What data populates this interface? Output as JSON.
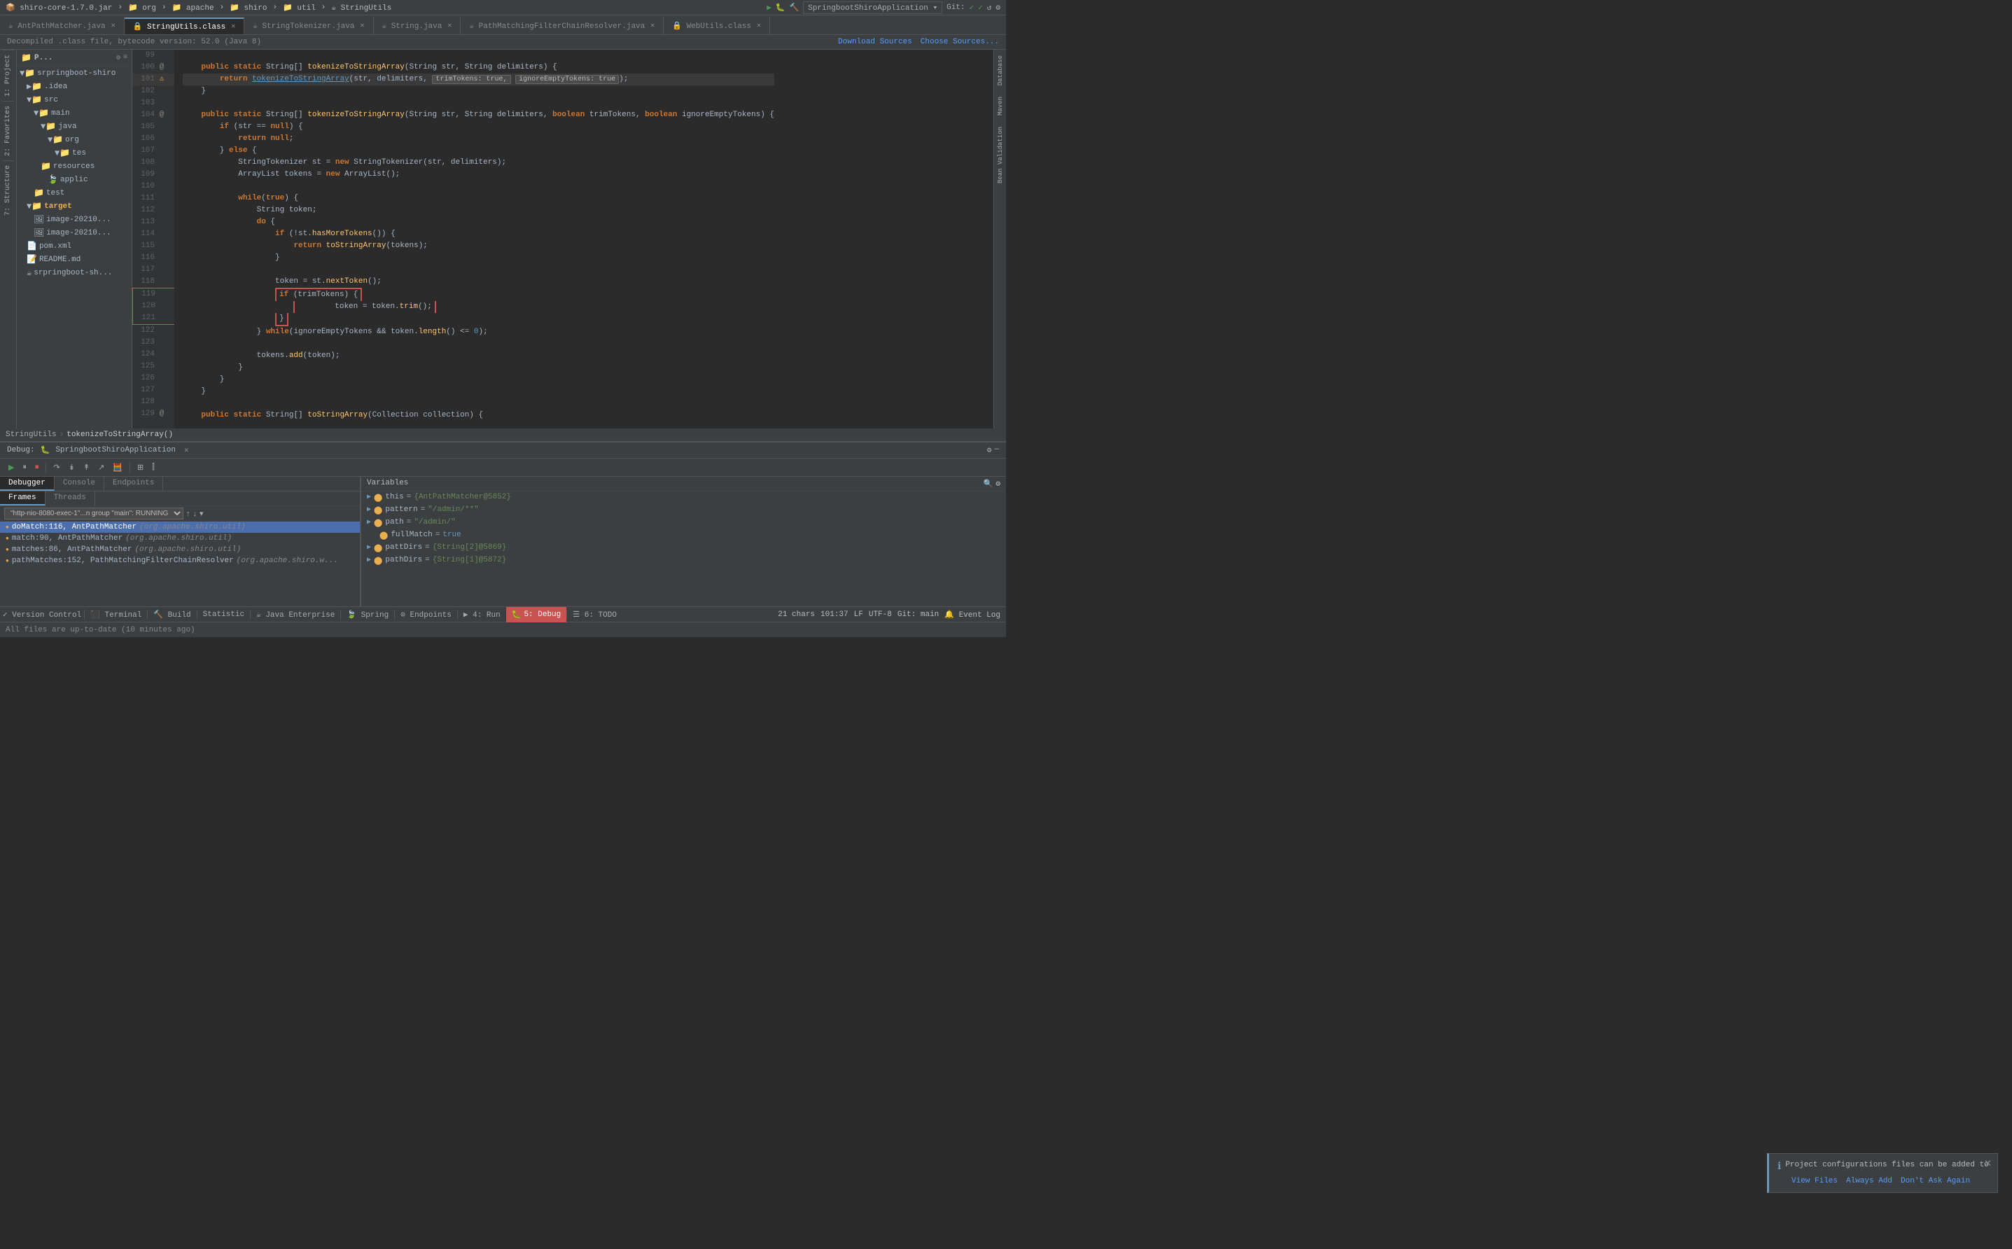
{
  "titlebar": {
    "items": [
      "shiro-core-1.7.0.jar",
      "org",
      "apache",
      "shiro",
      "util",
      "StringUtils"
    ],
    "app_dropdown": "SpringbootShiroApplication",
    "git_label": "Git:"
  },
  "tabs": [
    {
      "label": "AntPathMatcher.java",
      "active": false
    },
    {
      "label": "StringUtils.class",
      "active": true
    },
    {
      "label": "StringTokenizer.java",
      "active": false
    },
    {
      "label": "String.java",
      "active": false
    },
    {
      "label": "PathMatchingFilterChainResolver.java",
      "active": false
    },
    {
      "label": "WebUtils.class",
      "active": false
    }
  ],
  "decompile_bar": {
    "text": "Decompiled .class file, bytecode version: 52.0 (Java 8)",
    "link1": "Download Sources",
    "link2": "Choose Sources..."
  },
  "breadcrumb": {
    "items": [
      "StringUtils",
      "tokenizeToStringArray()"
    ]
  },
  "code_lines": [
    {
      "ln": "99",
      "gutter": "",
      "code": ""
    },
    {
      "ln": "100",
      "gutter": "@",
      "code": "    public static String[] tokenizeToStringArray(String str, String delimiters) {"
    },
    {
      "ln": "101",
      "gutter": "●",
      "code": "        return tokenizeToStringArray(str, delimiters,  trimTokens: true,  ignoreEmptyTokens: true);"
    },
    {
      "ln": "102",
      "gutter": "",
      "code": "    }"
    },
    {
      "ln": "103",
      "gutter": "",
      "code": ""
    },
    {
      "ln": "104",
      "gutter": "@",
      "code": "    public static String[] tokenizeToStringArray(String str, String delimiters, boolean trimTokens, boolean ignoreEmptyTokens) {"
    },
    {
      "ln": "105",
      "gutter": "",
      "code": "        if (str == null) {"
    },
    {
      "ln": "106",
      "gutter": "",
      "code": "            return null;"
    },
    {
      "ln": "107",
      "gutter": "",
      "code": "        } else {"
    },
    {
      "ln": "108",
      "gutter": "",
      "code": "            StringTokenizer st = new StringTokenizer(str, delimiters);"
    },
    {
      "ln": "109",
      "gutter": "",
      "code": "            ArrayList tokens = new ArrayList();"
    },
    {
      "ln": "110",
      "gutter": "",
      "code": ""
    },
    {
      "ln": "111",
      "gutter": "",
      "code": "            while(true) {"
    },
    {
      "ln": "112",
      "gutter": "",
      "code": "                String token;"
    },
    {
      "ln": "113",
      "gutter": "",
      "code": "                do {"
    },
    {
      "ln": "114",
      "gutter": "",
      "code": "                    if (!st.hasMoreTokens()) {"
    },
    {
      "ln": "115",
      "gutter": "",
      "code": "                        return toStringArray(tokens);"
    },
    {
      "ln": "116",
      "gutter": "",
      "code": "                    }"
    },
    {
      "ln": "117",
      "gutter": "",
      "code": ""
    },
    {
      "ln": "118",
      "gutter": "",
      "code": "                    token = st.nextToken();"
    },
    {
      "ln": "119",
      "gutter": "",
      "code": "                    if (trimTokens) {"
    },
    {
      "ln": "120",
      "gutter": "",
      "code": "                        token = token.trim();"
    },
    {
      "ln": "121",
      "gutter": "",
      "code": "                    }"
    },
    {
      "ln": "122",
      "gutter": "",
      "code": "                } while(ignoreEmptyTokens && token.length() <= 0);"
    },
    {
      "ln": "123",
      "gutter": "",
      "code": ""
    },
    {
      "ln": "124",
      "gutter": "",
      "code": "                tokens.add(token);"
    },
    {
      "ln": "125",
      "gutter": "",
      "code": "            }"
    },
    {
      "ln": "126",
      "gutter": "",
      "code": "        }"
    },
    {
      "ln": "127",
      "gutter": "",
      "code": "    }"
    },
    {
      "ln": "128",
      "gutter": "",
      "code": ""
    },
    {
      "ln": "129",
      "gutter": "@",
      "code": "    public static String[] toStringArray(Collection collection) {"
    }
  ],
  "project_tree": {
    "root": "srpringboot-shiro",
    "items": [
      {
        "label": ".idea",
        "indent": 1,
        "type": "folder"
      },
      {
        "label": "src",
        "indent": 1,
        "type": "folder"
      },
      {
        "label": "main",
        "indent": 2,
        "type": "folder"
      },
      {
        "label": "java",
        "indent": 3,
        "type": "folder"
      },
      {
        "label": "org",
        "indent": 4,
        "type": "folder"
      },
      {
        "label": "tes",
        "indent": 5,
        "type": "folder"
      },
      {
        "label": "resources",
        "indent": 3,
        "type": "folder"
      },
      {
        "label": "applic",
        "indent": 4,
        "type": "file-config"
      },
      {
        "label": "test",
        "indent": 2,
        "type": "folder"
      },
      {
        "label": "target",
        "indent": 1,
        "type": "folder",
        "expanded": true
      },
      {
        "label": "image-20210",
        "indent": 2,
        "type": "image"
      },
      {
        "label": "image-20210",
        "indent": 2,
        "type": "image"
      },
      {
        "label": "pom.xml",
        "indent": 1,
        "type": "xml",
        "selected": false
      },
      {
        "label": "README.md",
        "indent": 1,
        "type": "md"
      },
      {
        "label": "srpringboot-sh",
        "indent": 1,
        "type": "jar"
      }
    ]
  },
  "debug": {
    "title": "Debug:",
    "app": "SpringbootShiroApplication",
    "toolbar_buttons": [
      "▶",
      "⏸",
      "⏹",
      "↩",
      "↪",
      "↗",
      "↙",
      "↕",
      "☰",
      "⊞"
    ],
    "tabs": [
      "Debugger",
      "Console",
      "Endpoints"
    ],
    "frames_tabs": [
      "Frames",
      "Threads"
    ],
    "thread_label": "\"http-nio-8080-exec-1\"...n group \"main\": RUNNING",
    "frames": [
      {
        "label": "doMatch:116, AntPathMatcher",
        "detail": "(org.apache.shiro.util)",
        "active": true
      },
      {
        "label": "match:90, AntPathMatcher",
        "detail": "(org.apache.shiro.util)",
        "active": false
      },
      {
        "label": "matches:86, AntPathMatcher",
        "detail": "(org.apache.shiro.util)",
        "active": false
      },
      {
        "label": "pathMatches:152, PathMatchingFilterChainResolver",
        "detail": "(org.apache.shiro.w...",
        "active": false
      }
    ],
    "variables_header": "Variables",
    "variables": [
      {
        "indent": 0,
        "name": "this",
        "eq": "=",
        "val": "{AntPathMatcher@5852}",
        "expanded": true
      },
      {
        "indent": 0,
        "name": "pattern",
        "eq": "=",
        "val": "\"/admin/**\"",
        "expanded": false
      },
      {
        "indent": 0,
        "name": "path",
        "eq": "=",
        "val": "\"/admin/\"",
        "expanded": false
      },
      {
        "indent": 0,
        "name": "fullMatch",
        "eq": "=",
        "val": "true",
        "expanded": false
      },
      {
        "indent": 0,
        "name": "pattDirs",
        "eq": "=",
        "val": "= {String[2]@5869}",
        "expanded": false
      },
      {
        "indent": 0,
        "name": "pathDirs",
        "eq": "=",
        "val": "= {String[1]@5872}",
        "expanded": false
      }
    ]
  },
  "notification": {
    "text": "Project configurations files can be added to",
    "actions": [
      "View Files",
      "Always Add",
      "Don't Ask Again"
    ]
  },
  "statusbar": {
    "left": [
      "✓ Version Control",
      "⊞ Terminal",
      "☰ Build",
      "Statistic",
      "Java Enterprise",
      "Spring",
      "⊙ Endpoints",
      "▶ 4: Run",
      "🐛 5: Debug",
      "☰ 6: TODO"
    ],
    "right": [
      "21 chars",
      "101:37",
      "LF",
      "UTF-8",
      "Git: main"
    ],
    "files_status": "All files are up-to-date (10 minutes ago)",
    "event_log": "Event Log"
  },
  "colors": {
    "accent_blue": "#4b6eaf",
    "active_tab_border": "#6897bb",
    "bg_main": "#2b2b2b",
    "bg_secondary": "#3c3f41",
    "keyword": "#cc7832",
    "string": "#6a8759",
    "number": "#6897bb",
    "method": "#ffc66d",
    "red_debug": "#c75450",
    "orange": "#e8b04e"
  }
}
